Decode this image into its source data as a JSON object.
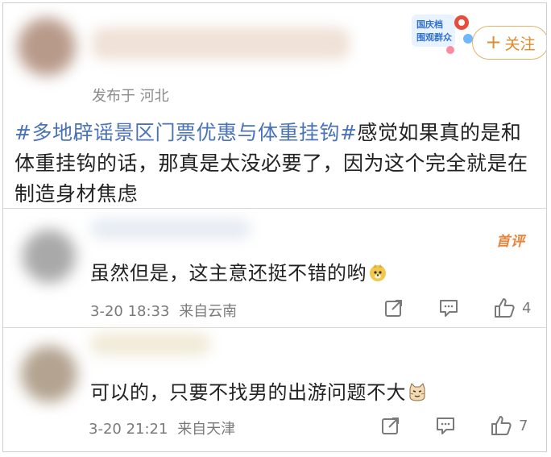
{
  "post": {
    "location": "发布于 河北",
    "hashtag": "#多地辟谣景区门票优惠与体重挂钩#",
    "body": "感觉如果真的是和体重挂钩的话，那真是太没必要了，因为这个完全就是在制造身材焦虑",
    "follow_label": "关注",
    "badge_text": "国庆档 围观群众"
  },
  "comments": [
    {
      "tag": "首评",
      "text": "虽然但是，这主意还挺不错的哟",
      "emoji": "doge-emoji",
      "time": "3-20 18:33",
      "source": "来自云南",
      "likes": "4"
    },
    {
      "text": "可以的，只要不找男的出游问题不大",
      "emoji": "cat-emoji",
      "time": "3-20 21:21",
      "source": "来自天津",
      "likes": "7"
    }
  ],
  "icons": [
    "share-icon",
    "comment-icon",
    "like-icon"
  ],
  "colors": {
    "hashtag": "#4a72b8",
    "follow": "#e08a2a",
    "first_tag": "#e8843a"
  }
}
